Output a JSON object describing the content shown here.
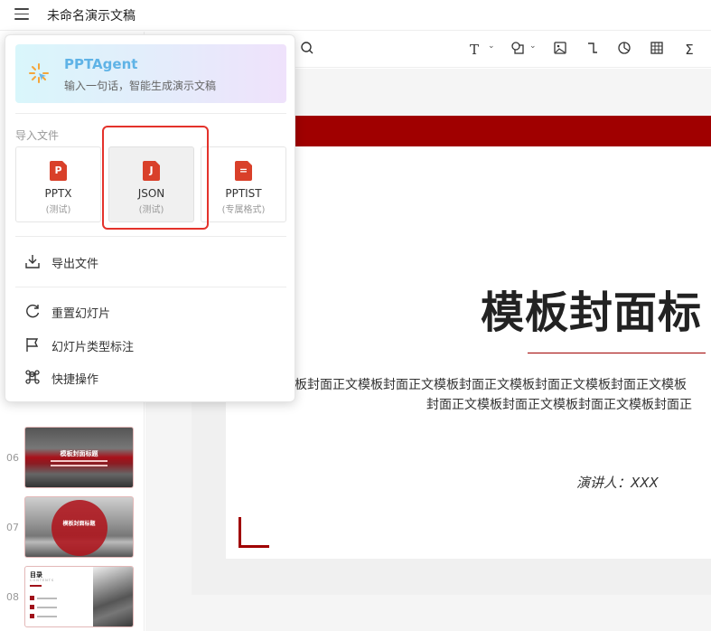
{
  "header": {
    "title": "未命名演示文稿"
  },
  "thumbnails": [
    {
      "number": "06",
      "title": "模板封面标题"
    },
    {
      "number": "07",
      "title": "模板封面标题"
    },
    {
      "number": "08",
      "title": "目录",
      "subtitle": "CONTENTS"
    }
  ],
  "slide": {
    "title": "模板封面标",
    "body_line1": "板封面正文模板封面正文模板封面正文模板封面正文模板封面正文模板",
    "body_line2": "封面正文模板封面正文模板封面正文模板封面正",
    "speaker": "演讲人：XXX",
    "accent_color": "#a00000"
  },
  "menu": {
    "agent": {
      "name": "PPTAgent",
      "description": "输入一句话，智能生成演示文稿"
    },
    "import_label": "导入文件",
    "import_options": [
      {
        "name": "PPTX",
        "sub": "(测试)",
        "icon_letter": "P"
      },
      {
        "name": "JSON",
        "sub": "(测试)",
        "icon_letter": "J"
      },
      {
        "name": "PPTIST",
        "sub": "(专属格式)",
        "icon_letter": "="
      }
    ],
    "export": "导出文件",
    "reset": "重置幻灯片",
    "slide_type": "幻灯片类型标注",
    "shortcuts": "快捷操作"
  }
}
